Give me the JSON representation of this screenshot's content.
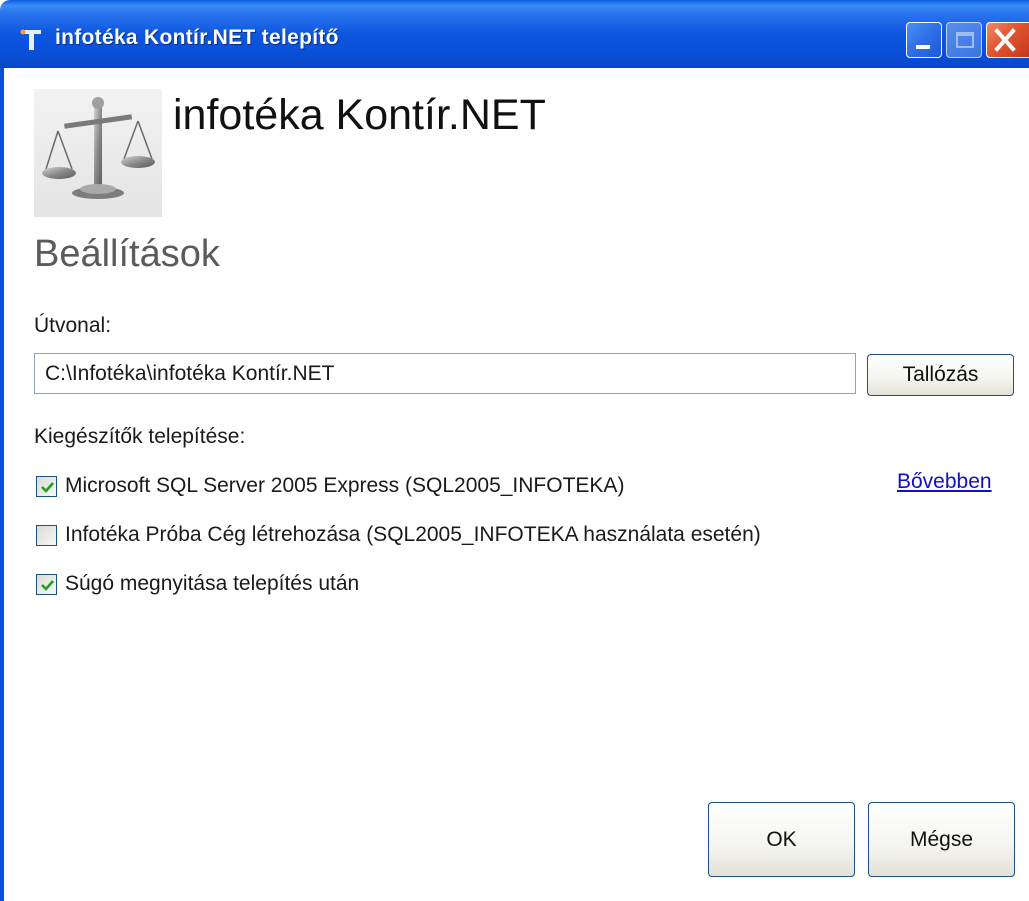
{
  "window": {
    "title": "infotéka Kontír.NET telepítő",
    "colors": {
      "titlebar": "#0a4fd6",
      "close": "#e0552f",
      "link": "#1010c8"
    }
  },
  "header": {
    "product_title": "infotéka Kontír.NET",
    "logo_icon": "scales-icon"
  },
  "section": {
    "title": "Beállítások"
  },
  "path": {
    "label": "Útvonal:",
    "value": "C:\\Infotéka\\infotéka Kontír.NET",
    "browse_label": "Tallózás"
  },
  "addons": {
    "label": "Kiegészítők telepítése:",
    "items": [
      {
        "label": "Microsoft SQL Server 2005 Express (SQL2005_INFOTEKA)",
        "checked": true
      },
      {
        "label": "Infotéka Próba Cég létrehozása (SQL2005_INFOTEKA használata esetén)",
        "checked": false
      },
      {
        "label": "Súgó megnyitása telepítés után",
        "checked": true
      }
    ],
    "more_link": "Bővebben"
  },
  "footer": {
    "ok_label": "OK",
    "cancel_label": "Mégse"
  }
}
